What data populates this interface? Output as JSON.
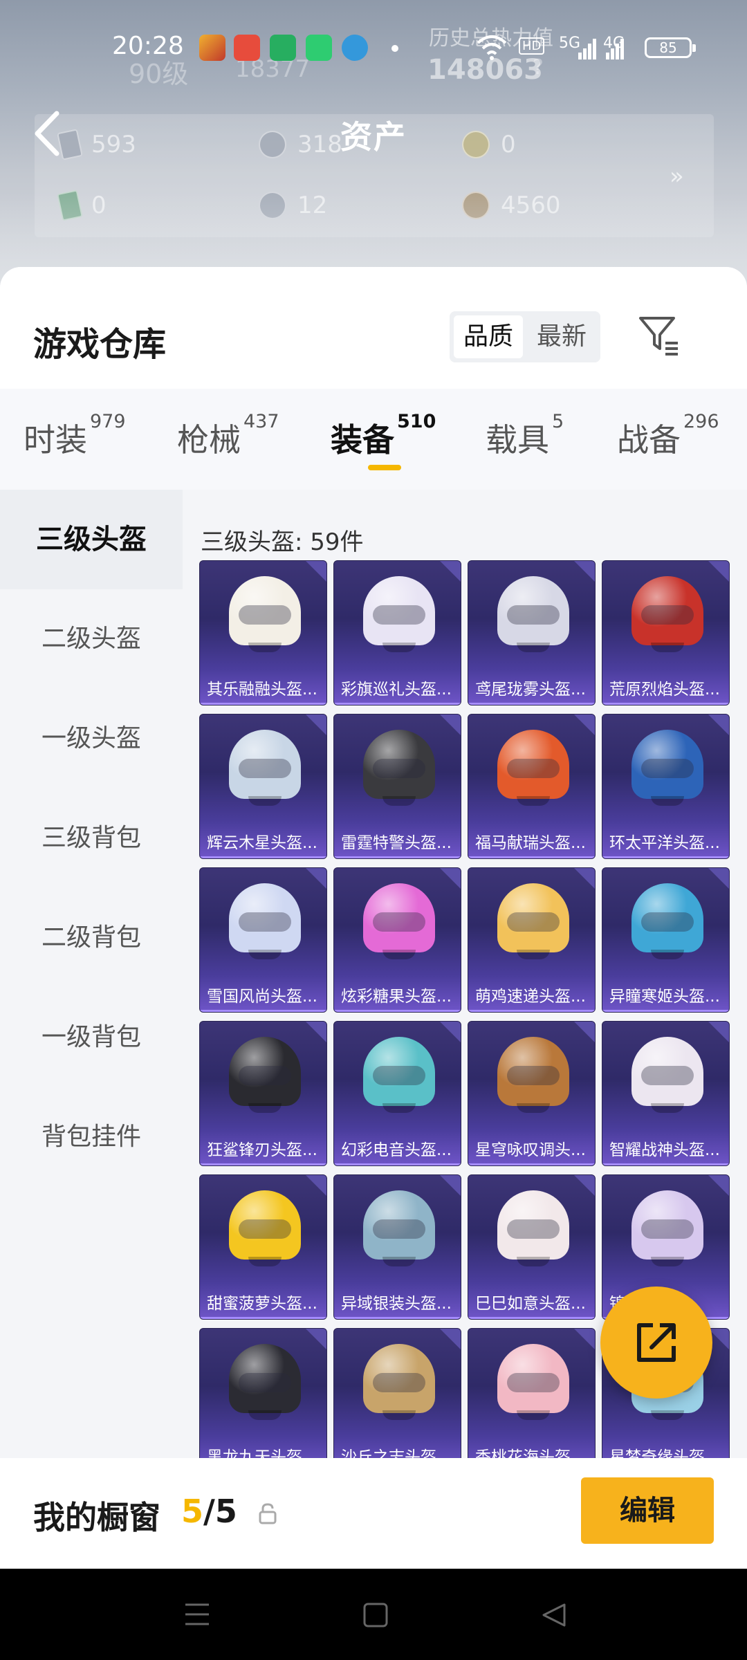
{
  "status_bar": {
    "time": "20:28",
    "network_1": "5G",
    "network_2": "4G",
    "hd": "HD",
    "battery": "85"
  },
  "background_ghost": {
    "top_label": "历史总热力值",
    "hot_value": "148063",
    "level": "90级",
    "id_partial": "18377",
    "question": "?"
  },
  "header": {
    "title": "资产",
    "back_icon": "chevron-left-icon"
  },
  "assets": [
    {
      "icon": "card-icon",
      "value": "593"
    },
    {
      "icon": "coin-icon",
      "value": "318"
    },
    {
      "icon": "token-icon",
      "value": "0"
    },
    {
      "icon": "card-icon",
      "value": "0"
    },
    {
      "icon": "coin-icon",
      "value": "12"
    },
    {
      "icon": "coin-icon",
      "value": "4560"
    }
  ],
  "assets_more": "»",
  "sheet": {
    "title": "游戏仓库",
    "sort": {
      "options": [
        "品质",
        "最新"
      ],
      "active": "品质"
    },
    "filter_icon": "filter-icon"
  },
  "tabs": [
    {
      "label": "时装",
      "count": "979"
    },
    {
      "label": "枪械",
      "count": "437"
    },
    {
      "label": "装备",
      "count": "510",
      "active": true
    },
    {
      "label": "载具",
      "count": "5"
    },
    {
      "label": "战备",
      "count": "296"
    }
  ],
  "sidebar": [
    {
      "label": "三级头盔",
      "active": true
    },
    {
      "label": "二级头盔"
    },
    {
      "label": "一级头盔"
    },
    {
      "label": "三级背包"
    },
    {
      "label": "二级背包"
    },
    {
      "label": "一级背包"
    },
    {
      "label": "背包挂件"
    }
  ],
  "category_count": "三级头盔: 59件",
  "items": [
    {
      "name": "其乐融融头盔...",
      "color": "#f3efe6"
    },
    {
      "name": "彩旗巡礼头盔...",
      "color": "#e8e4f4"
    },
    {
      "name": "鸢尾珑雾头盔...",
      "color": "#d7d8e6"
    },
    {
      "name": "荒原烈焰头盔...",
      "color": "#c8322a"
    },
    {
      "name": "辉云木星头盔...",
      "color": "#c8d6e6"
    },
    {
      "name": "雷霆特警头盔...",
      "color": "#3a3a3e"
    },
    {
      "name": "福马献瑞头盔...",
      "color": "#e35a2b"
    },
    {
      "name": "环太平洋头盔...",
      "color": "#2d64b8"
    },
    {
      "name": "雪国风尚头盔...",
      "color": "#cfd8f2"
    },
    {
      "name": "炫彩糖果头盔...",
      "color": "#e46ad6"
    },
    {
      "name": "萌鸡速递头盔...",
      "color": "#f2c25a"
    },
    {
      "name": "异瞳寒姬头盔...",
      "color": "#3fa7d6"
    },
    {
      "name": "狂鲨锋刃头盔...",
      "color": "#2a2a30"
    },
    {
      "name": "幻彩电音头盔...",
      "color": "#5ac0c8"
    },
    {
      "name": "星穹咏叹调头...",
      "color": "#b9783a"
    },
    {
      "name": "智耀战神头盔...",
      "color": "#ece6f0"
    },
    {
      "name": "甜蜜菠萝头盔...",
      "color": "#f4c620"
    },
    {
      "name": "异域银装头盔...",
      "color": "#8fb4c8"
    },
    {
      "name": "巳巳如意头盔...",
      "color": "#f2e8ea"
    },
    {
      "name": "锦...头盔...",
      "color": "#d7c8ee"
    },
    {
      "name": "黑龙九天头盔...",
      "color": "#2b2b33"
    },
    {
      "name": "沙丘之志头盔...",
      "color": "#c8a46a"
    },
    {
      "name": "香桃花海头盔...",
      "color": "#f2b8c4"
    },
    {
      "name": "星梦奇缘头盔...",
      "color": "#9ad0e6"
    }
  ],
  "showcase": {
    "label": "我的橱窗",
    "current": "5",
    "separator": "/",
    "total": "5",
    "edit_label": "编辑"
  },
  "fab_icon": "share-export-icon",
  "accent": "#f5b700"
}
